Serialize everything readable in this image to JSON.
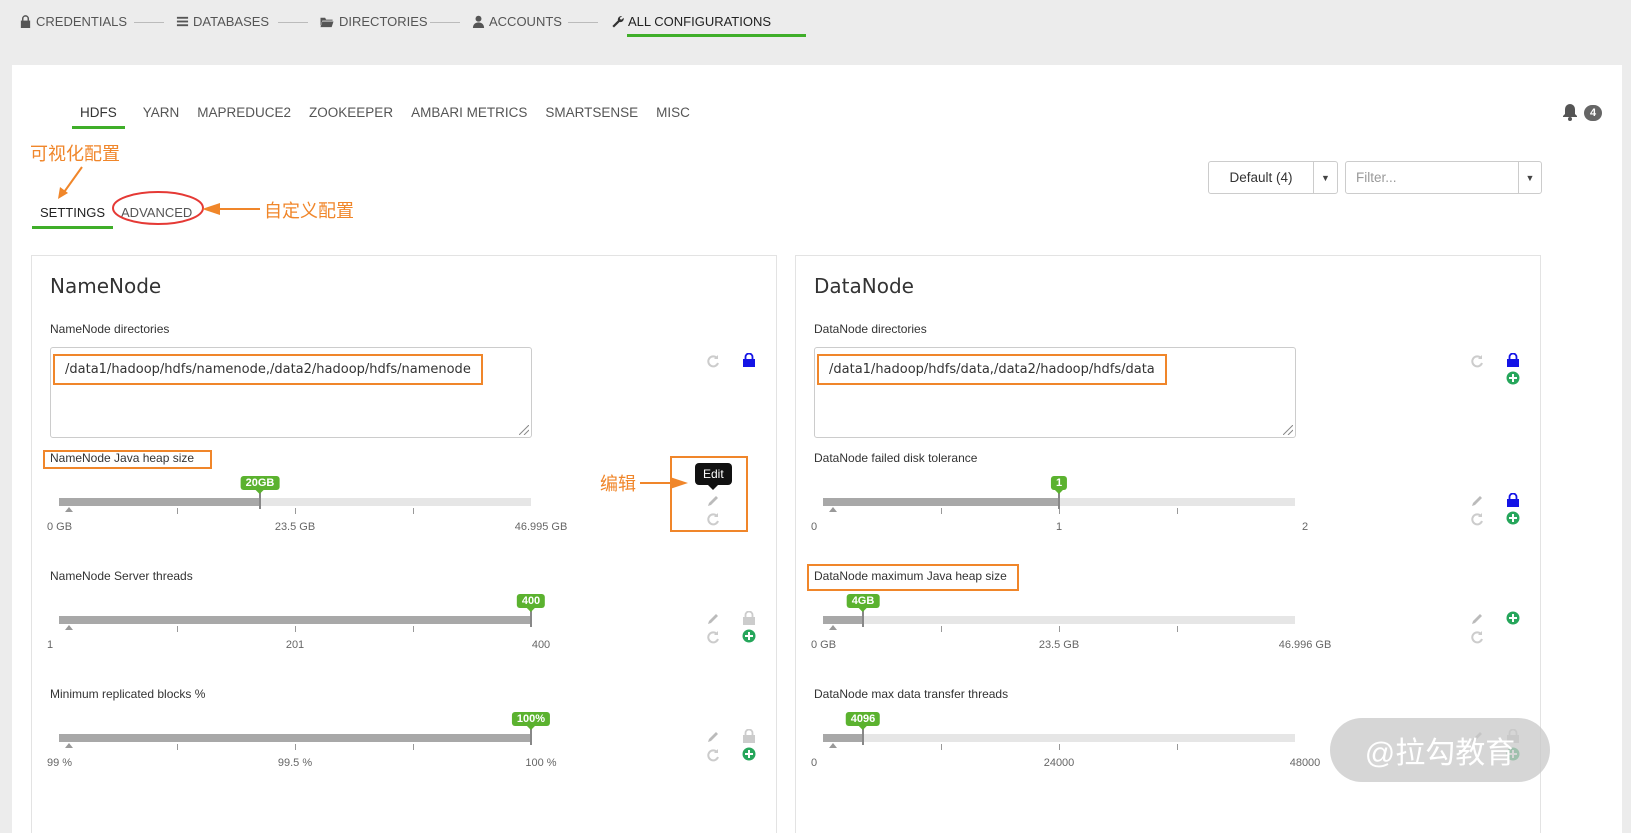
{
  "steps": [
    {
      "label": "CREDENTIALS",
      "icon": "lock-icon"
    },
    {
      "label": "DATABASES",
      "icon": "list-icon"
    },
    {
      "label": "DIRECTORIES",
      "icon": "folder-open-icon"
    },
    {
      "label": "ACCOUNTS",
      "icon": "user-icon"
    },
    {
      "label": "ALL CONFIGURATIONS",
      "icon": "wrench-icon",
      "active": true
    }
  ],
  "services": [
    "HDFS",
    "YARN",
    "MAPREDUCE2",
    "ZOOKEEPER",
    "AMBARI METRICS",
    "SMARTSENSE",
    "MISC"
  ],
  "active_service": "HDFS",
  "alerts_count": "4",
  "sub_tabs": {
    "settings": "SETTINGS",
    "advanced": "ADVANCED"
  },
  "config_group": {
    "label": "Default (4)"
  },
  "filter": {
    "placeholder": "Filter..."
  },
  "annotations": {
    "visual": "可视化配置",
    "custom": "自定义配置",
    "edit": "编辑"
  },
  "tooltip": "Edit",
  "namenode": {
    "title": "NameNode",
    "dirs_label": "NameNode directories",
    "dirs_value": "/data1/hadoop/hdfs/namenode,/data2/hadoop/hdfs/namenode",
    "heap": {
      "label": "NameNode Java heap size",
      "value": "20GB",
      "fraction": 0.4256,
      "ticks": [
        "0 GB",
        "23.5 GB",
        "46.995 GB"
      ]
    },
    "threads": {
      "label": "NameNode Server threads",
      "value": "400",
      "fraction": 1.0,
      "ticks": [
        "1",
        "201",
        "400"
      ]
    },
    "blocks": {
      "label": "Minimum replicated blocks %",
      "value": "100%",
      "fraction": 1.0,
      "ticks": [
        "99 %",
        "99.5 %",
        "100 %"
      ]
    }
  },
  "datanode": {
    "title": "DataNode",
    "dirs_label": "DataNode directories",
    "dirs_value": "/data1/hadoop/hdfs/data,/data2/hadoop/hdfs/data",
    "disk": {
      "label": "DataNode failed disk tolerance",
      "value": "1",
      "fraction": 0.5,
      "ticks": [
        "0",
        "1",
        "2"
      ]
    },
    "heap": {
      "label": "DataNode maximum Java heap size",
      "value": "4GB",
      "fraction": 0.0851,
      "ticks": [
        "0 GB",
        "23.5 GB",
        "46.996 GB"
      ]
    },
    "transfer": {
      "label": "DataNode max data transfer threads",
      "value": "4096",
      "fraction": 0.0853,
      "ticks": [
        "0",
        "24000",
        "48000"
      ]
    }
  },
  "watermark": "@拉勾教育",
  "colors": {
    "accent": "#3fae29",
    "annotation": "#f0862a",
    "lock_active": "#1414e6",
    "add": "#26a65b"
  }
}
